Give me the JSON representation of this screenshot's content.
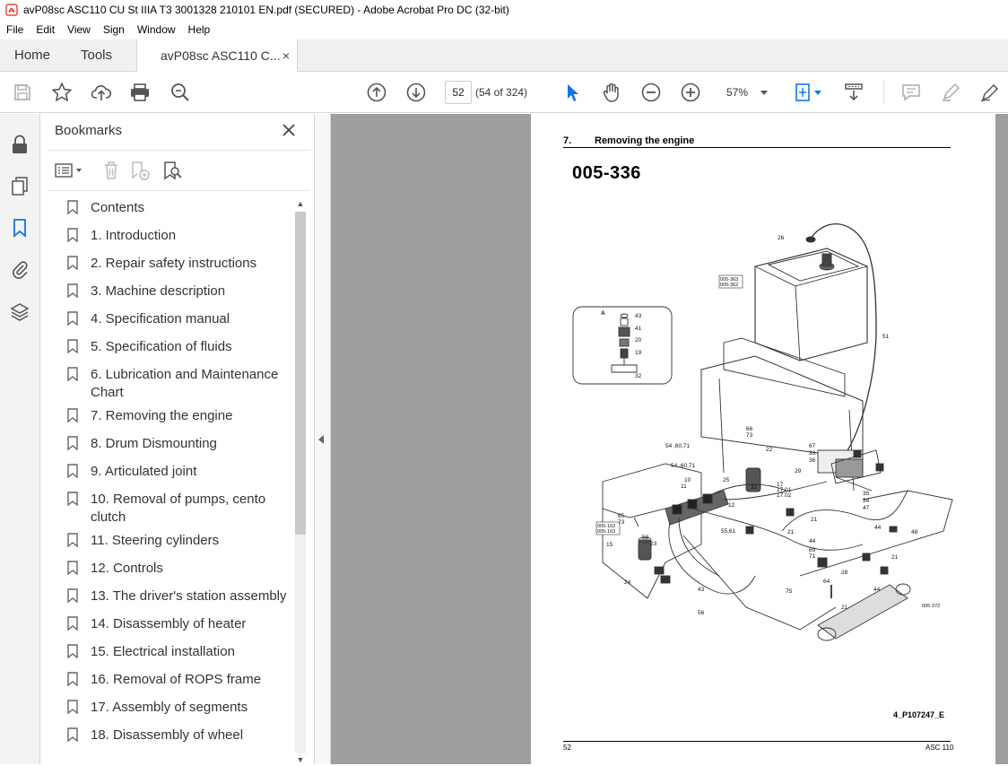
{
  "window": {
    "title": "avP08sc ASC110 CU St IIIA T3 3001328 210101 EN.pdf (SECURED) - Adobe Acrobat Pro DC (32-bit)"
  },
  "menu": {
    "items": [
      "File",
      "Edit",
      "View",
      "Sign",
      "Window",
      "Help"
    ]
  },
  "tabs": {
    "home": "Home",
    "tools": "Tools",
    "document": "avP08sc ASC110 C...",
    "close": "×"
  },
  "toolbar": {
    "page_number": "52",
    "page_count": "(54 of 324)",
    "zoom": "57%"
  },
  "bookmarks": {
    "title": "Bookmarks",
    "items": [
      {
        "label": "Contents"
      },
      {
        "label": "1. Introduction"
      },
      {
        "label": "2. Repair safety instructions"
      },
      {
        "label": "3. Machine description"
      },
      {
        "label": "4. Specification manual"
      },
      {
        "label": "5. Specification of fluids"
      },
      {
        "label": "6. Lubrication and Maintenance Chart"
      },
      {
        "label": "7. Removing the engine"
      },
      {
        "label": "8. Drum Dismounting"
      },
      {
        "label": "9. Articulated joint"
      },
      {
        "label": "10. Removal of pumps, cento clutch"
      },
      {
        "label": "11. Steering cylinders"
      },
      {
        "label": "12. Controls"
      },
      {
        "label": "13. The driver's station assembly"
      },
      {
        "label": "14. Disassembly of heater"
      },
      {
        "label": "15. Electrical installation"
      },
      {
        "label": "16. Removal of ROPS frame"
      },
      {
        "label": "17. Assembly of segments"
      },
      {
        "label": "18. Disassembly of wheel"
      }
    ]
  },
  "page": {
    "section_number": "7.",
    "section_title": "Removing the engine",
    "figure_code": "005-336",
    "figure_ref": "4_P107247_E",
    "footer_page": "52",
    "footer_model": "ASC 110",
    "callouts": {
      "detail_label": "A",
      "detail_numbers": [
        "43",
        "41",
        "20",
        "19",
        "32"
      ],
      "ref_boxes": [
        "005-363",
        "005-362",
        "005-162",
        "005-163",
        "005-372"
      ],
      "numbers": [
        "26",
        "51",
        "66",
        "73",
        "54 ,60,71",
        "22",
        "67",
        "33",
        "36",
        "54 ,60,71",
        "10",
        "11",
        "25",
        "32",
        "17",
        "17.01",
        "17.02",
        "29",
        "35",
        "34",
        "47",
        "12",
        "21",
        "44",
        "48",
        "65",
        "73",
        "58",
        "23",
        "15",
        "55,61",
        "44",
        "21",
        "69",
        "71",
        "28",
        "21",
        "24",
        "43",
        "56",
        "75",
        "64",
        "44",
        "21"
      ]
    }
  },
  "colors": {
    "accent": "#1473e6",
    "doc_bg": "#9e9e9e",
    "pdf_red": "#d9261c"
  }
}
